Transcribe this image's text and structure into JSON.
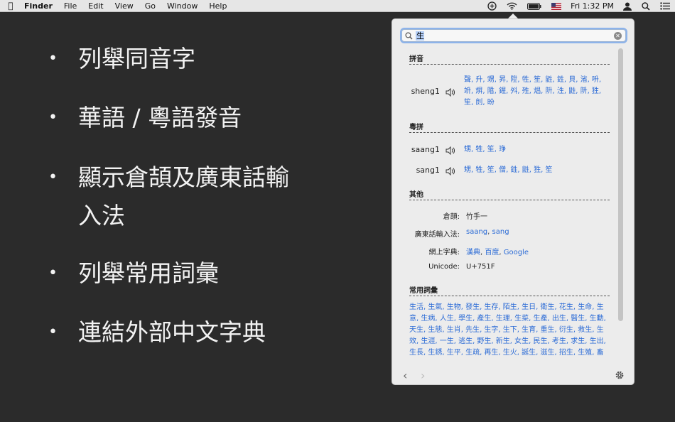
{
  "menubar": {
    "app_name": "Finder",
    "menus": [
      "File",
      "Edit",
      "View",
      "Go",
      "Window",
      "Help"
    ],
    "clock": "Fri 1:32 PM",
    "tray_icons": [
      "dictionary-add-icon",
      "wifi-icon",
      "battery-icon",
      "flag-us-icon",
      "user-icon",
      "spotlight-search-icon",
      "notification-list-icon"
    ]
  },
  "features": [
    {
      "bullet": "•",
      "text": "列舉同音字"
    },
    {
      "bullet": "•",
      "text": "華語 / 粵語發音"
    },
    {
      "bullet": "•",
      "text": "顯示倉頡及廣東話輸入法"
    },
    {
      "bullet": "•",
      "text": "列舉常用詞彙"
    },
    {
      "bullet": "•",
      "text": "連結外部中文字典"
    }
  ],
  "popover": {
    "search": {
      "value": "生",
      "placeholder": ""
    },
    "pinyin": {
      "title": "拼音",
      "rows": [
        {
          "label": "sheng1",
          "chars": "聲, 升, 甥, 昇, 陞, 牲, 笙, 鼪, 鉎, 貝, 渻, 呏, 竔, 焺, 陹, 鍟, 斘, 殅, 焻, 阩, 泩, 鼪, 阩, 狌, 笙, 剆, 昐"
        }
      ]
    },
    "jyutping": {
      "title": "粵拼",
      "rows": [
        {
          "label": "saang1",
          "chars": "甥, 牲, 笙, 琤"
        },
        {
          "label": "sang1",
          "chars": "甥, 牲, 笙, 僧, 鉎, 鼪, 狌, 笙"
        }
      ]
    },
    "other": {
      "title": "其他",
      "cangjie_label": "倉頡:",
      "cangjie_value": "竹手一",
      "cantonese_ime_label": "廣東話輸入法:",
      "cantonese_ime_values": [
        "saang",
        "sang"
      ],
      "online_dict_label": "網上字典:",
      "online_dict_values": [
        "漢典",
        "百度",
        "Google"
      ],
      "unicode_label": "Unicode:",
      "unicode_value": "U+751F"
    },
    "vocab": {
      "title": "常用詞彙",
      "items": "生活, 生氣, 生物, 發生, 生存, 陌生, 生日, 衛生, 花生, 生命, 生意, 生病, 人生, 學生, 產生, 生理, 生菜, 生產, 出生, 醫生, 生動, 天生, 生態, 生肖, 先生, 生字, 生下, 生育, 重生, 衍生, 救生, 生效, 生涯, 一生, 逃生, 野生, 新生, 女生, 民生, 考生, 求生, 生出, 生長, 生銹, 生平, 生疏, 再生, 生火, 誕生, 滋生, 招生, 生殖, 畜生, 一生, 生人, 生化, 生殺, 生肚, 維生, 養生, 永生, 終生, 男生"
    }
  }
}
